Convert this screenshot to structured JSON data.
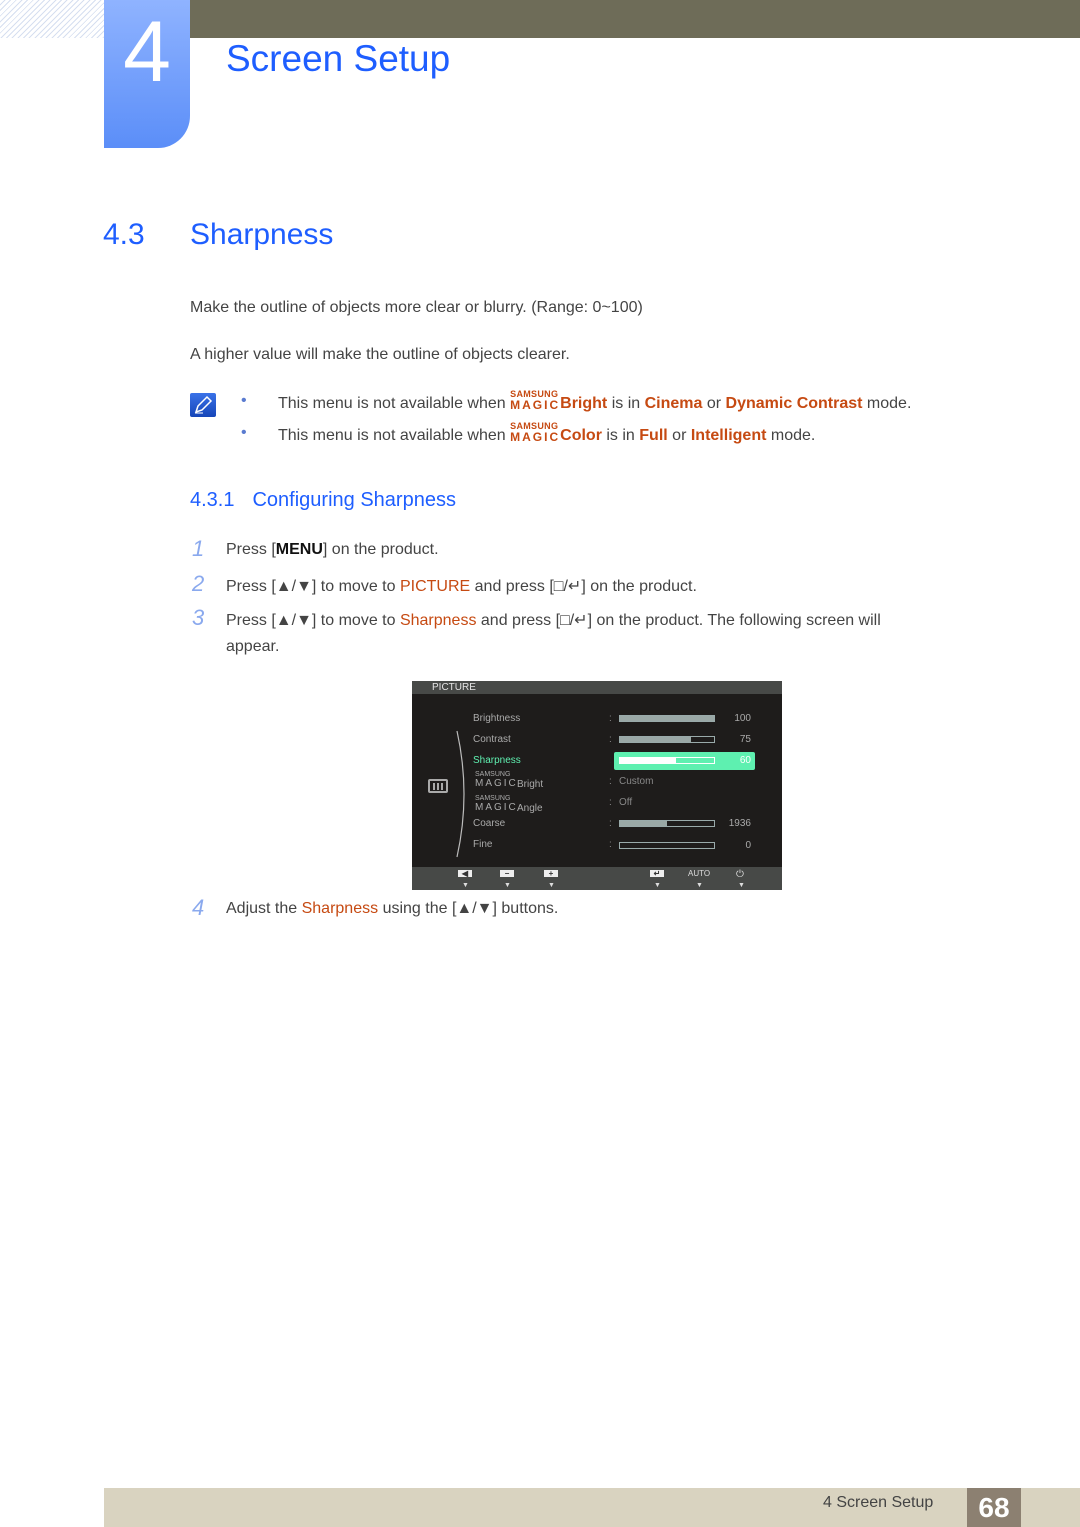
{
  "chapter": {
    "number": "4",
    "title": "Screen Setup"
  },
  "section": {
    "number": "4.3",
    "title": "Sharpness"
  },
  "intro": [
    "Make the outline of objects more clear or blurry. (Range: 0~100)",
    "A higher value will make the outline of objects clearer."
  ],
  "notes": [
    {
      "pre": "This menu is not available when",
      "brand_top": "SAMSUNG",
      "brand_bottom": "MAGIC",
      "feature": "Bright",
      "mid": "is in",
      "opt1": "Cinema",
      "or": "or",
      "opt2": "Dynamic Contrast",
      "post": "mode."
    },
    {
      "pre": "This menu is not available when",
      "brand_top": "SAMSUNG",
      "brand_bottom": "MAGIC",
      "feature": "Color",
      "mid": "is in",
      "opt1": "Full",
      "or": "or",
      "opt2": "Intelligent",
      "post": "mode."
    }
  ],
  "subsection": {
    "number": "4.3.1",
    "title": "Configuring Sharpness"
  },
  "steps": [
    {
      "num": "1",
      "a": "Press [",
      "key": "MENU",
      "b": "] on the product."
    },
    {
      "num": "2",
      "a": "Press [▲/▼] to move to",
      "hl": "PICTURE",
      "b": "and press [□/↵] on the product."
    },
    {
      "num": "3",
      "a": "Press [▲/▼] to move to",
      "hl": "Sharpness",
      "b": "and press [□/↵] on the product. The following screen will",
      "c": "appear."
    },
    {
      "num": "4",
      "a": "Adjust the",
      "hl": "Sharpness",
      "b": "using the [▲/▼] buttons."
    }
  ],
  "osd": {
    "title": "PICTURE",
    "items": [
      {
        "label": "Brightness",
        "value": "100",
        "fraction": 1.0
      },
      {
        "label": "Contrast",
        "value": "75",
        "fraction": 0.75
      },
      {
        "label": "Sharpness",
        "value": "60",
        "fraction": 0.6,
        "selected": true
      },
      {
        "brand_top": "SAMSUNG",
        "brand_bottom": "MAGIC",
        "label": "Bright",
        "text": "Custom"
      },
      {
        "brand_top": "SAMSUNG",
        "brand_bottom": "MAGIC",
        "label": "Angle",
        "text": "Off"
      },
      {
        "label": "Coarse",
        "value": "1936",
        "fraction": 0.5
      },
      {
        "label": "Fine",
        "value": "0",
        "fraction": 0.0
      }
    ],
    "footer": {
      "auto": "AUTO",
      "buttons": [
        "left-icon",
        "minus-icon",
        "plus-icon",
        "enter-icon",
        "auto",
        "power-icon"
      ]
    }
  },
  "footer": {
    "text": "4 Screen Setup",
    "page": "68"
  }
}
